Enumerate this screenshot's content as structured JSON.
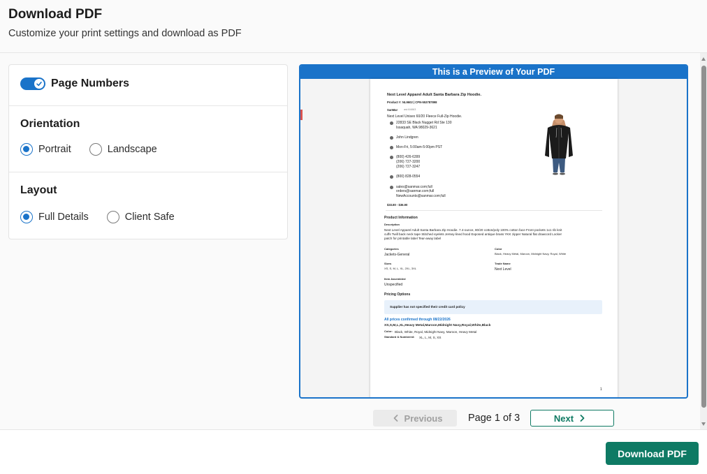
{
  "header": {
    "title": "Download PDF",
    "subtitle": "Customize your print settings and download as PDF"
  },
  "settings": {
    "page_numbers": {
      "label": "Page Numbers",
      "enabled": true
    },
    "orientation": {
      "title": "Orientation",
      "options": [
        {
          "label": "Portrait",
          "selected": true
        },
        {
          "label": "Landscape",
          "selected": false
        }
      ]
    },
    "layout": {
      "title": "Layout",
      "options": [
        {
          "label": "Full Details",
          "selected": true
        },
        {
          "label": "Client Safe",
          "selected": false
        }
      ]
    }
  },
  "preview": {
    "banner": "This is a Preview of Your PDF",
    "doc": {
      "product_title": "Next Level Apparel Adult Santa Barbara Zip Hoodie.",
      "product_ids": "Product #: NL9602  |  CPN-553787898",
      "supplier_name": "SanMar",
      "supplier_id": "asi:84863",
      "supplier_desc": "Next Level Unisex 60/20 Fleece Full-Zip Hoodie.",
      "address_1": "22833 SE Black Nugget Rd Ste 130",
      "address_2": "Issaquah, WA 98029-3621",
      "contact": "John Lindgren",
      "hours": "Mon-Fri, 5:00am-5:00pm PST",
      "phone_1": "(800) 426-6399",
      "phone_2": "(206) 727-3200",
      "phone_3": "(206) 727-3247",
      "fax": "(800) 828-0554",
      "email_1": "sales@sanmar.com;full",
      "email_2": "orders@sanmar.com;full",
      "email_3": "NewAccounts@sanmar.com;full",
      "price_range": "$33.80 - $36.90",
      "product_info_title": "Product Information",
      "description_label": "Description",
      "description_line_1": "Next Level Apparel Adult Santa Barbara Zip Hoodie. 7.4-ounce, 80/20 cotton/poly 100% cotton face Front pockets 1x1 rib knit",
      "description_line_2": "cuffs Twill back neck tape Stitched eyelets Jersey-lined hood Exposed antique brass YKK zipper Natural flat drawcord Locker",
      "description_line_3": "patch for printable label Tear-away label",
      "categories_label": "Categories",
      "categories_value": "Jackets-General",
      "color_label": "Color",
      "color_value": "Black, Heavy Metal, Maroon, Midnight Navy, Royal, White",
      "sizes_label": "Sizes",
      "sizes_value": "XS, S, M, L, XL, 2XL, 3XL",
      "trade_name_label": "Trade Name",
      "trade_name_value": "Next Level",
      "item_assembled_label": "Item Assembled",
      "item_assembled_value": "Unspecified",
      "pricing_title": "Pricing Options",
      "policy_text": "Supplier has not specified their credit card policy",
      "prices_confirmed": "All prices confirmed through 08/22/2026",
      "price_variant": "XS,S,M,L,XL,Heavy Metal,Maroon,Midnight Navy,Royal,White,Black",
      "variant_color_label": "Color:",
      "variant_color_value": "Black, White, Royal, Midnight Navy, Maroon, Heavy Metal",
      "variant_sizes_label": "Standard & Numbered:",
      "variant_sizes_value": "XL, L, M, S, XS",
      "page_number": "1"
    }
  },
  "pager": {
    "previous_label": "Previous",
    "page_indicator": "Page 1 of 3",
    "next_label": "Next"
  },
  "footer": {
    "download_label": "Download PDF"
  },
  "colors": {
    "accent_blue": "#1a73c9",
    "brand_green": "#0e7a64"
  }
}
